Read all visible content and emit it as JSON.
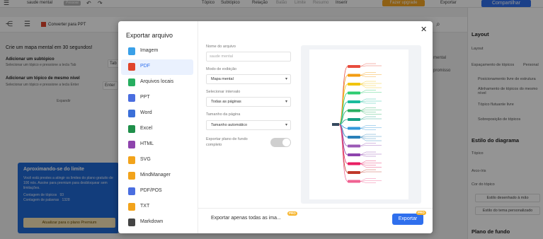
{
  "app": {
    "doc_name": "saude mental",
    "doc_badge": "Pessoal",
    "menu": [
      "Tópico",
      "Subtópico",
      "Relação",
      "Balão",
      "Limite",
      "Resumo",
      "Inserir"
    ],
    "upgrade_label": "Fazer upgrade",
    "export_label": "Exportar",
    "share_label": "Compartilhar",
    "convert_label": "Converter para PPT"
  },
  "left": {
    "heading": "Crie um mapa mental em 30 segundos!",
    "sub1_title": "Adicionar um subtópico",
    "sub1_text": "Selecionar um tópico e pressione a tecla Tab",
    "tab_label": "Tab",
    "sub2_title": "Adicionar um tópico de mesmo nível",
    "sub2_text": "Selecionar um tópico e pressione a tecla Enter",
    "enter_label": "Enter",
    "collapse_label": "Expandir"
  },
  "limit": {
    "title": "Aproximando-se do limite",
    "text": "Você está prestes a atingir os limites do plano gratuito de 100 nós. Assine para premium para desbloquear sem limitações.",
    "topics_label": "Contagem de tópicos",
    "topics_value": "93",
    "words_label": "Contagem de palavras",
    "words_value": "1328",
    "button": "Atualizar para o plano Premium"
  },
  "right": {
    "layout_heading": "Layout",
    "layout_label": "Layout",
    "spacing_label": "Espaçamento de tópicos",
    "spacing_value": "Personal",
    "opt1": "Posicionamento livre de estrutura",
    "opt2": "Alinhamento de tópicos do mesmo nível",
    "opt3": "Tópico flutuante livre",
    "opt4": "Sobreposição de tópicos",
    "style_heading": "Estilo do diagrama",
    "topic_label": "Tópico",
    "branch_label": "Arco-íris",
    "color_label": "Cor do tópico",
    "hand_drawn": "Estilo desenhado à mão",
    "custom_theme": "Estilo do tema personalizado",
    "bg_heading": "Plano de fundo",
    "extra1": "mental",
    "extra2": "promisso"
  },
  "dialog": {
    "title": "Exportar arquivo",
    "formats": [
      {
        "label": "Imagem",
        "color": "#3aa0e8"
      },
      {
        "label": "PDF",
        "color": "#e0442b"
      },
      {
        "label": "Arquivos locais",
        "color": "#27ae60"
      },
      {
        "label": "PPT",
        "color": "#4a6ee0"
      },
      {
        "label": "Word",
        "color": "#3b6fd8"
      },
      {
        "label": "Excel",
        "color": "#1f8f4a"
      },
      {
        "label": "HTML",
        "color": "#8e44ad"
      },
      {
        "label": "SVG",
        "color": "#f2a31b"
      },
      {
        "label": "MindManager",
        "color": "#f2a31b"
      },
      {
        "label": "PDF/POS",
        "color": "#4a6ee0"
      },
      {
        "label": "TXT",
        "color": "#f2a31b"
      },
      {
        "label": "Markdown",
        "color": "#444444"
      }
    ],
    "selected_index": 1,
    "file_name_label": "Nome do arquivo",
    "file_name_placeholder": "saude mental",
    "view_mode_label": "Modo de exibição",
    "view_mode_value": "Mapa mental",
    "range_label": "Selecionar intervalo",
    "range_value": "Todas as páginas",
    "page_size_label": "Tamanho da página",
    "page_size_value": "Tamanho automático",
    "bg_label": "Exportar plano de fundo completo",
    "bg_toggle_on": false,
    "footer_text": "Exportar apenas todas as ima...",
    "pro_badge": "PRO",
    "export_button": "Exportar"
  },
  "colors": {
    "accent": "#2f6fed",
    "selected_bg": "#eaf1fe",
    "pro": "#f7b52c"
  }
}
